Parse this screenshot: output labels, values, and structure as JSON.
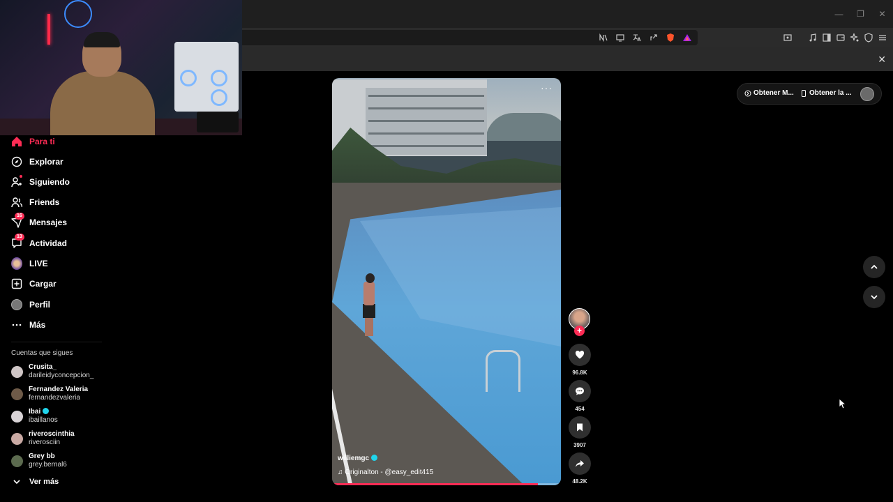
{
  "browser": {
    "window_buttons": [
      "—",
      "❐",
      "✕"
    ],
    "infobar_close": "✕"
  },
  "sidebar": {
    "nav": [
      {
        "label": "Para ti",
        "icon": "home-icon",
        "active": true
      },
      {
        "label": "Explorar",
        "icon": "compass-icon"
      },
      {
        "label": "Siguiendo",
        "icon": "following-icon"
      },
      {
        "label": "Friends",
        "icon": "friends-icon"
      },
      {
        "label": "Mensajes",
        "icon": "messages-icon",
        "badge": "16"
      },
      {
        "label": "Actividad",
        "icon": "activity-icon",
        "badge": "13"
      },
      {
        "label": "LIVE",
        "icon": "live-avatar-icon"
      },
      {
        "label": "Cargar",
        "icon": "upload-icon"
      },
      {
        "label": "Perfil",
        "icon": "profile-avatar-icon"
      },
      {
        "label": "Más",
        "icon": "more-icon"
      }
    ],
    "following_title": "Cuentas que sigues",
    "following": [
      {
        "name": "Crusita_",
        "username": "darileidyconcepcion_",
        "verified": false
      },
      {
        "name": "Fernandez Valeria",
        "username": "fernandezvaleria",
        "verified": false
      },
      {
        "name": "Ibai",
        "username": "ibaillanos",
        "verified": true
      },
      {
        "name": "riveroscinthia",
        "username": "riverosciin",
        "verified": false
      },
      {
        "name": "Grey bb",
        "username": "grey.bernal6",
        "verified": false
      }
    ],
    "see_more": "Ver más"
  },
  "video": {
    "menu": "···",
    "author": "williemgc",
    "author_verified": true,
    "sound": "Originalton - @easy_edit415",
    "progress": 0.9
  },
  "actions": {
    "likes": "96.8K",
    "comments": "454",
    "saves": "3907",
    "shares": "48.2K",
    "follow_plus": "+"
  },
  "top_right": {
    "get_coins": "Obtener M...",
    "get_app": "Obtener la ..."
  },
  "colors": {
    "accent": "#fe2c55",
    "verified": "#20d5ec",
    "background": "#000000"
  }
}
